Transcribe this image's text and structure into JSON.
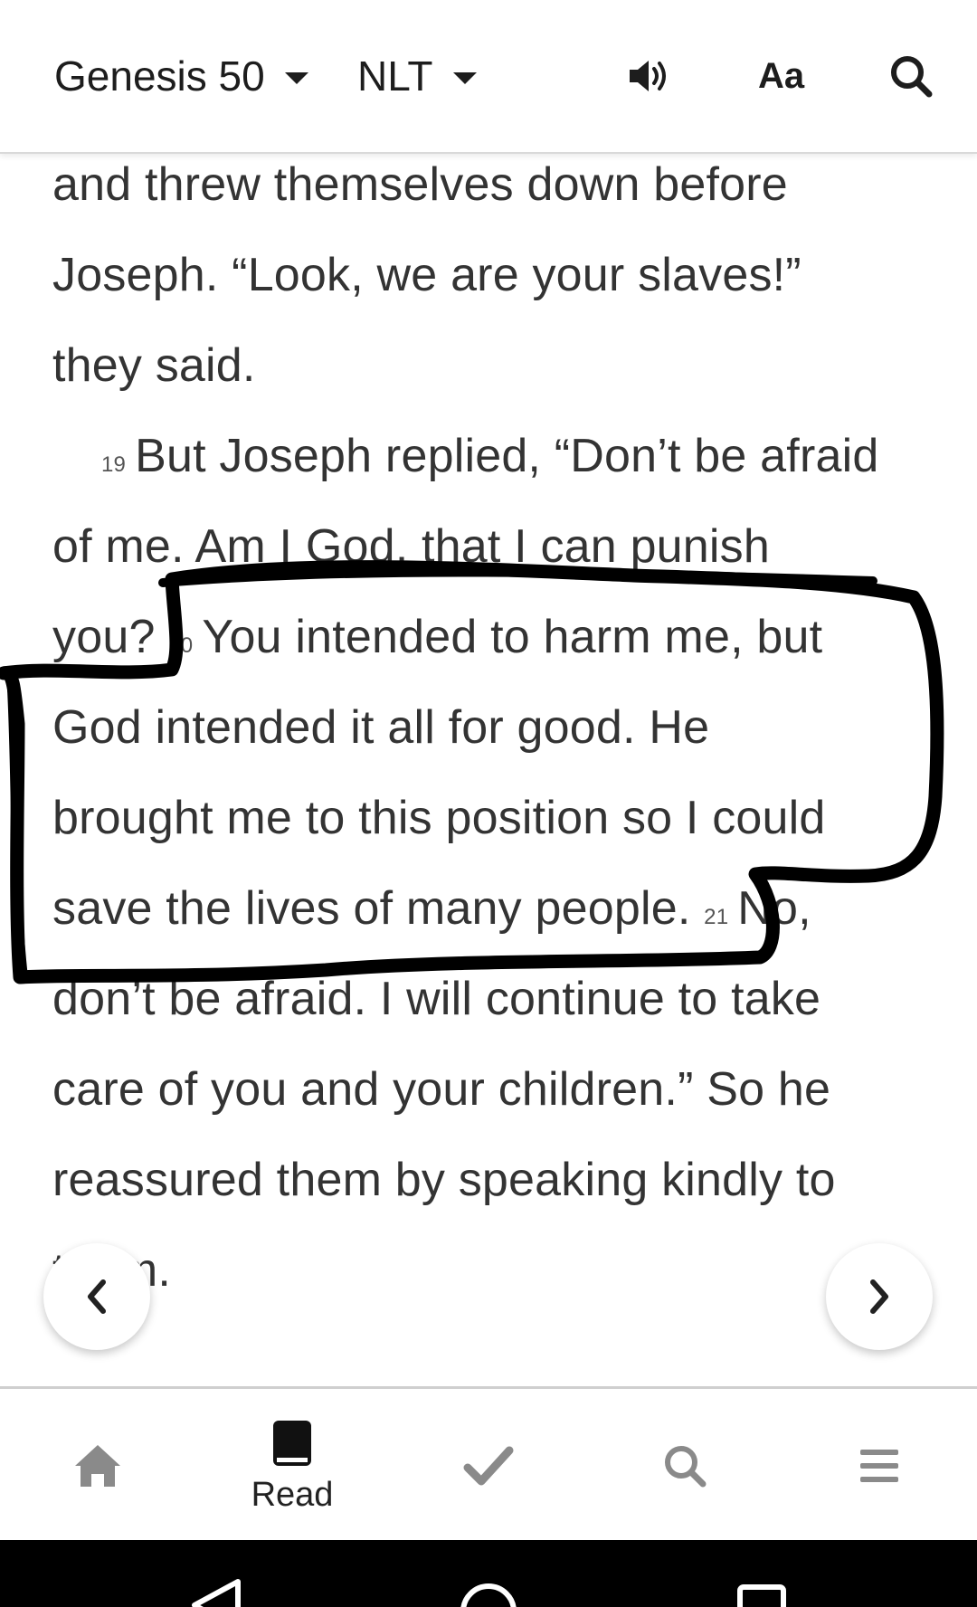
{
  "header": {
    "book_chapter": "Genesis 50",
    "version": "NLT",
    "font_label": "Aa"
  },
  "reader": {
    "lines": [
      {
        "text": "and threw themselves down before"
      },
      {
        "text": "Joseph. “Look, we are your slaves!”"
      },
      {
        "text": "they said."
      },
      {
        "verse": "19",
        "text": "But Joseph replied, “Don’t be afraid"
      },
      {
        "text": "of me. Am I God, that I can punish"
      },
      {
        "text": "you?",
        "verse_after": "20",
        "text_after": "You intended to harm me, but"
      },
      {
        "text": "God intended it all for good. He"
      },
      {
        "text": "brought me to this position so I could"
      },
      {
        "text": "save the lives of many people.",
        "verse_after": "21",
        "text_after": "No,"
      },
      {
        "text": "don’t be afraid. I will continue to take"
      },
      {
        "text": "care of you and your children.” So he"
      },
      {
        "text": "reassured them by speaking kindly to"
      },
      {
        "text": "them."
      }
    ]
  },
  "bottom_nav": {
    "read_label": "Read"
  }
}
